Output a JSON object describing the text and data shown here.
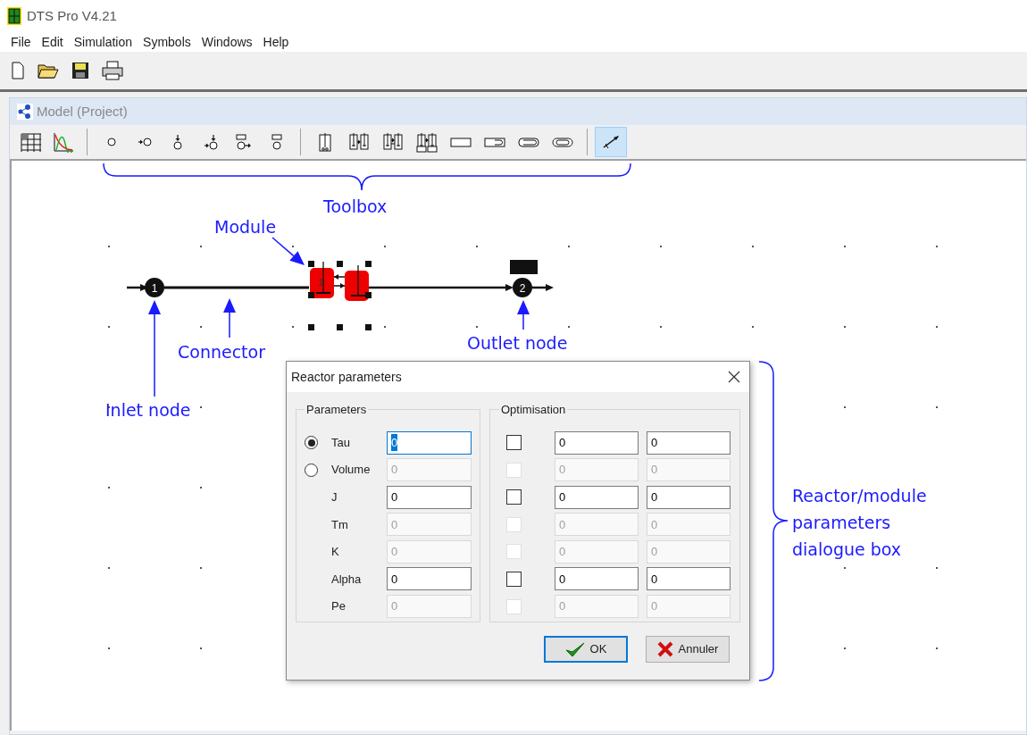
{
  "window": {
    "title": "DTS Pro V4.21"
  },
  "menu": [
    "File",
    "Edit",
    "Simulation",
    "Symbols",
    "Windows",
    "Help"
  ],
  "model_window": {
    "title": "Model (Project)",
    "toolbox": [
      {
        "tools": [
          {
            "kind": "grid",
            "selected": false
          },
          {
            "kind": "curve",
            "selected": false
          }
        ]
      },
      {
        "tools": [
          {
            "kind": "node",
            "selected": false
          },
          {
            "kind": "node-in",
            "selected": false
          },
          {
            "kind": "node-top",
            "selected": false
          },
          {
            "kind": "node-in-top",
            "selected": false
          },
          {
            "kind": "node-box-out",
            "selected": false
          },
          {
            "kind": "node-box",
            "selected": false
          }
        ]
      },
      {
        "tools": [
          {
            "kind": "reactor",
            "selected": false
          },
          {
            "kind": "reactor-pair",
            "selected": false
          },
          {
            "kind": "reactor-exchange",
            "selected": false
          },
          {
            "kind": "reactor-stack",
            "selected": false
          },
          {
            "kind": "plug",
            "selected": false
          },
          {
            "kind": "plug-out",
            "selected": false
          },
          {
            "kind": "loop",
            "selected": false
          },
          {
            "kind": "loop-double",
            "selected": false
          }
        ]
      },
      {
        "tools": [
          {
            "kind": "connector",
            "selected": true
          }
        ]
      }
    ],
    "diagram": {
      "inlet_node": {
        "label": "1"
      },
      "module": {
        "label": "1",
        "selected": true
      },
      "outlet_node": {
        "label": "2"
      }
    }
  },
  "annotations": {
    "toolbox": "Toolbox",
    "module": "Module",
    "connector": "Connector",
    "inlet_node": "Inlet node",
    "outlet_node": "Outlet node",
    "dialog": "Reactor/module parameters dialogue box"
  },
  "dialog": {
    "title": "Reactor parameters",
    "parameters": {
      "title": "Parameters",
      "rows": [
        {
          "kind": "radio",
          "label": "Tau",
          "selected": true,
          "value": "0",
          "enabled": true,
          "focused": true
        },
        {
          "kind": "radio",
          "label": "Volume",
          "selected": false,
          "value": "0",
          "enabled": false,
          "focused": false
        },
        {
          "kind": "plain",
          "label": "J",
          "value": "0",
          "enabled": true,
          "focused": false
        },
        {
          "kind": "plain",
          "label": "Tm",
          "value": "0",
          "enabled": false,
          "focused": false
        },
        {
          "kind": "plain",
          "label": "K",
          "value": "0",
          "enabled": false,
          "focused": false
        },
        {
          "kind": "plain",
          "label": "Alpha",
          "value": "0",
          "enabled": true,
          "focused": false
        },
        {
          "kind": "plain",
          "label": "Pe",
          "value": "0",
          "enabled": false,
          "focused": false
        }
      ]
    },
    "optimisation": {
      "title": "Optimisation",
      "rows": [
        {
          "checked": false,
          "enabled": true,
          "min": "0",
          "max": "0"
        },
        {
          "checked": false,
          "enabled": false,
          "min": "0",
          "max": "0"
        },
        {
          "checked": false,
          "enabled": true,
          "min": "0",
          "max": "0"
        },
        {
          "checked": false,
          "enabled": false,
          "min": "0",
          "max": "0"
        },
        {
          "checked": false,
          "enabled": false,
          "min": "0",
          "max": "0"
        },
        {
          "checked": false,
          "enabled": true,
          "min": "0",
          "max": "0"
        },
        {
          "checked": false,
          "enabled": false,
          "min": "0",
          "max": "0"
        }
      ]
    },
    "buttons": [
      {
        "kind": "ok",
        "label": "OK",
        "default": true
      },
      {
        "kind": "cancel",
        "label": "Annuler",
        "default": false
      }
    ]
  }
}
